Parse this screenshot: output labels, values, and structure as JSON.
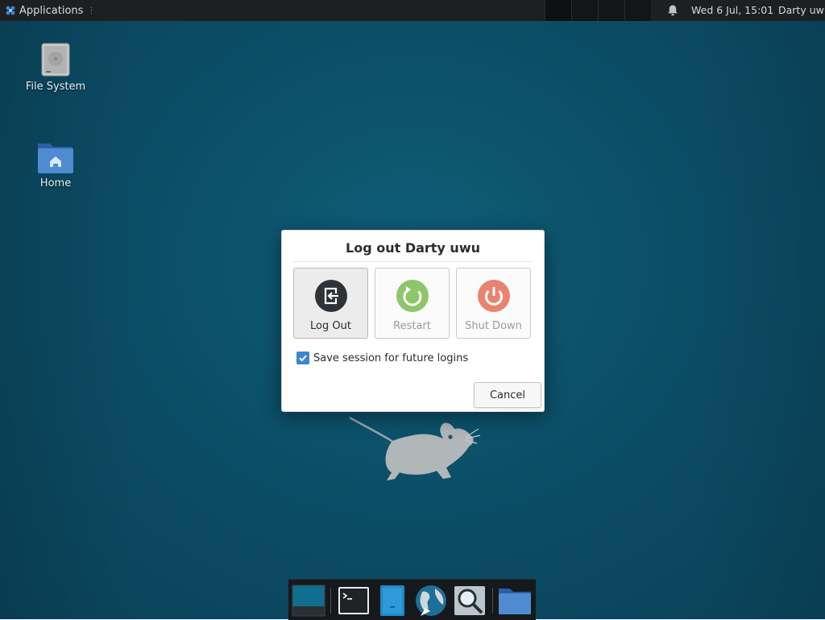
{
  "panel": {
    "applications_label": "Applications",
    "clock": "Wed  6 Jul, 15:01",
    "user": "Darty uwu"
  },
  "desktop": {
    "icons": [
      {
        "label": "File System",
        "icon": "hard-drive-icon"
      },
      {
        "label": "Home",
        "icon": "home-folder-icon"
      }
    ]
  },
  "dialog": {
    "title": "Log out Darty uwu",
    "actions": [
      {
        "label": "Log Out",
        "icon": "logout-icon",
        "color": "#2f3336",
        "state": "selected"
      },
      {
        "label": "Restart",
        "icon": "restart-icon",
        "color": "#8dc66b",
        "state": "disabled"
      },
      {
        "label": "Shut Down",
        "icon": "power-icon",
        "color": "#e8836f",
        "state": "disabled"
      }
    ],
    "save_session_label": "Save session for future logins",
    "save_session_checked": true,
    "cancel_label": "Cancel"
  },
  "dock": {
    "items": [
      "show-desktop-icon",
      "terminal-icon",
      "file-manager-icon",
      "web-browser-icon",
      "app-finder-icon",
      "folder-icon"
    ]
  },
  "colors": {
    "wallpaper": "#0b4e67",
    "accent": "#3b87d0",
    "panel": "#1d1f21"
  }
}
